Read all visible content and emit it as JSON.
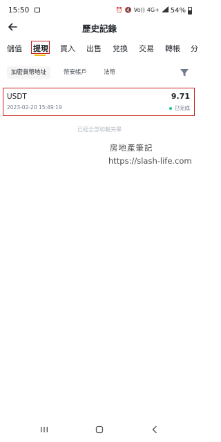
{
  "status_bar": {
    "time": "15:50",
    "battery": "54%",
    "icons": [
      "alarm-icon",
      "mute-icon",
      "volte-icon",
      "4g-icon",
      "signal-icon",
      "battery-icon"
    ],
    "volte": "Vo))",
    "network": "4G+"
  },
  "header": {
    "title": "歷史記錄"
  },
  "tabs": [
    {
      "label": "儲值"
    },
    {
      "label": "提現"
    },
    {
      "label": "買入"
    },
    {
      "label": "出售"
    },
    {
      "label": "兌換"
    },
    {
      "label": "交易"
    },
    {
      "label": "轉帳"
    },
    {
      "label": "分"
    }
  ],
  "active_tab": "提現",
  "filters": [
    {
      "label": "加密貨幣地址"
    },
    {
      "label": "幣安帳戶"
    },
    {
      "label": "法幣"
    }
  ],
  "record": {
    "coin": "USDT",
    "amount": "9.71",
    "time": "2023-02-20 15:49:19",
    "status": "已完成",
    "status_color": "#0ecb81"
  },
  "end_note": "已經全部加載完畢",
  "watermark": {
    "line1": "房地產筆記",
    "line2": "https://slash-life.com"
  },
  "colors": {
    "accent": "#f0b90b",
    "highlight": "#c8201f"
  }
}
